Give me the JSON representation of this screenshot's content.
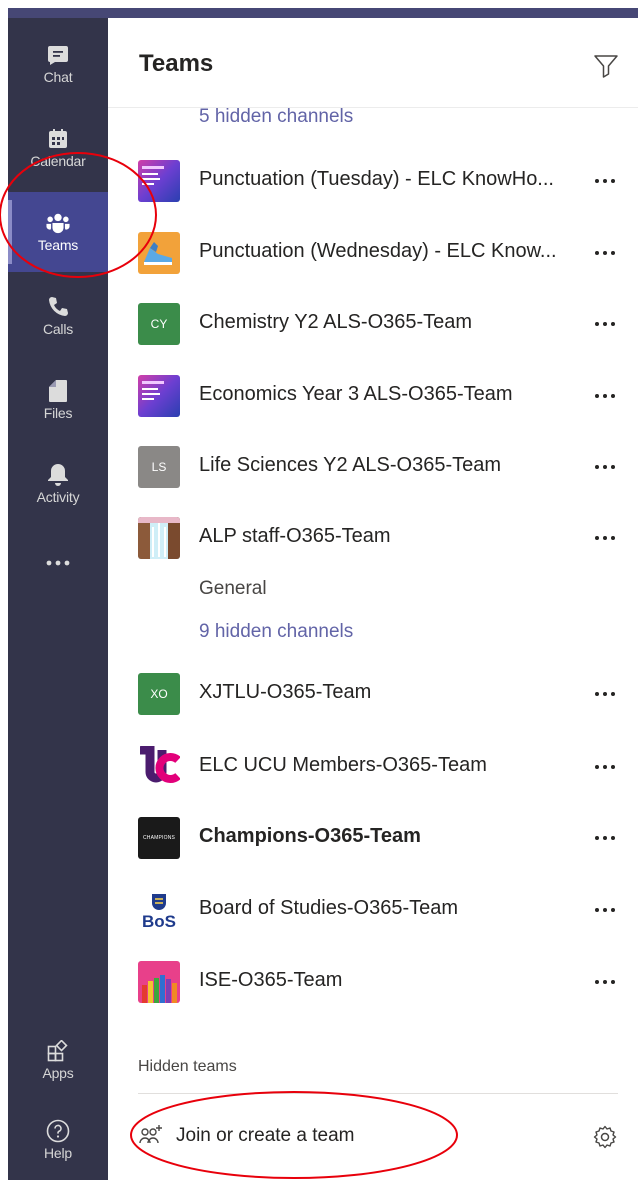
{
  "rail": {
    "items": [
      {
        "label": "Chat",
        "icon": "chat-icon"
      },
      {
        "label": "Calendar",
        "icon": "calendar-icon"
      },
      {
        "label": "Teams",
        "icon": "teams-icon",
        "active": true
      },
      {
        "label": "Calls",
        "icon": "phone-icon"
      },
      {
        "label": "Files",
        "icon": "file-icon"
      },
      {
        "label": "Activity",
        "icon": "bell-icon"
      },
      {
        "label": "",
        "icon": "more-icon"
      }
    ],
    "apps_label": "Apps",
    "help_label": "Help"
  },
  "panel": {
    "title": "Teams",
    "hidden_channels_top": "5 hidden channels",
    "general_channel": "General",
    "hidden_channels_alp": "9 hidden channels",
    "teams": [
      {
        "name": "Punctuation (Tuesday) - ELC KnowHo...",
        "avatar": "elc-logo",
        "bold": false
      },
      {
        "name": "Punctuation (Wednesday) - ELC Know...",
        "avatar": "sneaker-image",
        "bold": false
      },
      {
        "name": "Chemistry Y2 ALS-O365-Team",
        "avatar_initials": "CY",
        "avatar_color": "#3b8c4a",
        "bold": false
      },
      {
        "name": "Economics Year 3 ALS-O365-Team",
        "avatar": "elc-logo",
        "bold": false
      },
      {
        "name": "Life Sciences Y2 ALS-O365-Team",
        "avatar_initials": "LS",
        "avatar_color": "#8a8886",
        "bold": false
      },
      {
        "name": "ALP staff-O365-Team",
        "avatar": "waterfall-image",
        "bold": false
      },
      {
        "name": "XJTLU-O365-Team",
        "avatar_initials": "XO",
        "avatar_color": "#3b8c4a",
        "bold": false
      },
      {
        "name": "ELC UCU Members-O365-Team",
        "avatar": "ucu-logo",
        "bold": false
      },
      {
        "name": "Champions-O365-Team",
        "avatar": "champions-logo",
        "avatar_text": "CHAMPIONS",
        "bold": true
      },
      {
        "name": "Board of Studies-O365-Team",
        "avatar": "bos-logo",
        "avatar_text": "BoS",
        "bold": false
      },
      {
        "name": "ISE-O365-Team",
        "avatar": "pencils-image",
        "bold": false
      }
    ],
    "hidden_teams_label": "Hidden teams",
    "join_label": "Join or create a team"
  },
  "colors": {
    "rail_bg": "#33344a",
    "rail_active": "#444791",
    "top_bar": "#464775",
    "link": "#6264a7",
    "annotation": "#e8000b"
  }
}
